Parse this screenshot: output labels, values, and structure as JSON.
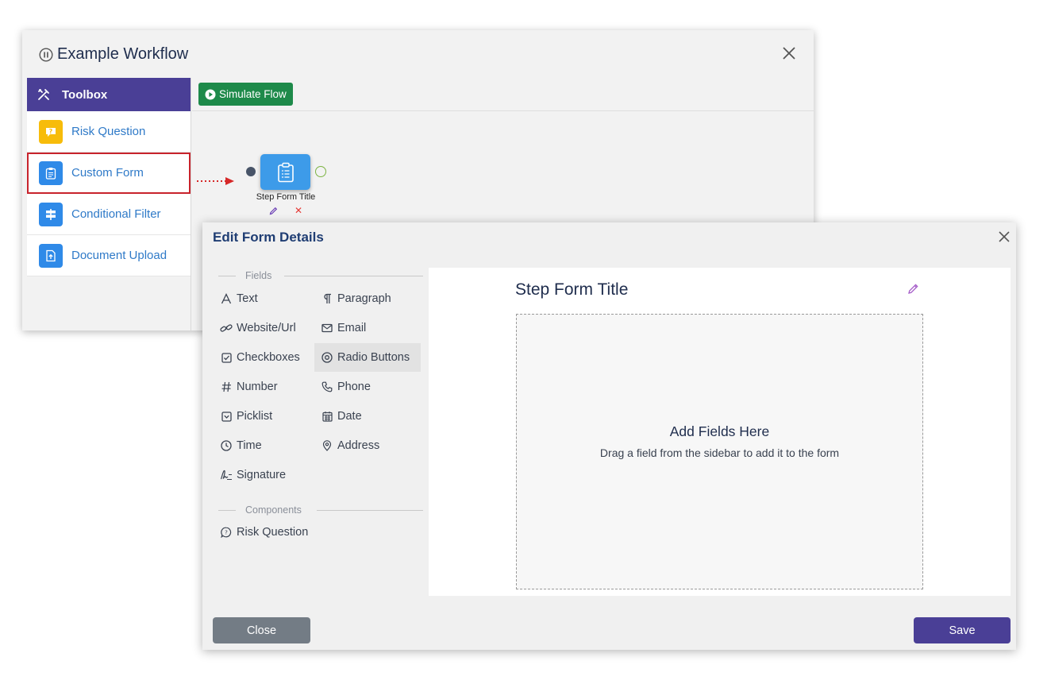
{
  "workflow": {
    "title": "Example Workflow",
    "toolbox": {
      "title": "Toolbox",
      "items": [
        {
          "label": "Risk Question",
          "icon": "risk-question-icon",
          "color": "#f7bc0a"
        },
        {
          "label": "Custom Form",
          "icon": "clipboard-icon",
          "color": "#2f8ae8",
          "selected": true
        },
        {
          "label": "Conditional Filter",
          "icon": "signpost-icon",
          "color": "#2f8ae8"
        },
        {
          "label": "Document Upload",
          "icon": "upload-file-icon",
          "color": "#2f8ae8"
        }
      ]
    },
    "simulate_label": "Simulate Flow",
    "node": {
      "label": "Step Form Title",
      "icon": "clipboard-icon"
    }
  },
  "dialog": {
    "title": "Edit Form Details",
    "fields_section": "Fields",
    "fields": [
      {
        "label": "Text",
        "icon": "text-icon"
      },
      {
        "label": "Paragraph",
        "icon": "paragraph-icon"
      },
      {
        "label": "Website/Url",
        "icon": "link-icon"
      },
      {
        "label": "Email",
        "icon": "email-icon"
      },
      {
        "label": "Checkboxes",
        "icon": "checkbox-icon"
      },
      {
        "label": "Radio Buttons",
        "icon": "radio-icon"
      },
      {
        "label": "Number",
        "icon": "hash-icon"
      },
      {
        "label": "Phone",
        "icon": "phone-icon"
      },
      {
        "label": "Picklist",
        "icon": "picklist-icon"
      },
      {
        "label": "Date",
        "icon": "calendar-icon"
      },
      {
        "label": "Time",
        "icon": "clock-icon"
      },
      {
        "label": "Address",
        "icon": "map-pin-icon"
      },
      {
        "label": "Signature",
        "icon": "signature-icon"
      }
    ],
    "components_section": "Components",
    "components": [
      {
        "label": "Risk Question",
        "icon": "risk-question-icon"
      }
    ],
    "form": {
      "title": "Step Form Title",
      "drop_title": "Add Fields Here",
      "drop_subtitle": "Drag a field from the sidebar to add it to the form"
    },
    "close_label": "Close",
    "save_label": "Save"
  },
  "colors": {
    "toolbox_header": "#4a3f96",
    "simulate_button": "#1e8a4a",
    "node": "#3d9be9",
    "highlight_border": "#c8232c",
    "save_button": "#4a3f96",
    "close_button": "#737c85"
  }
}
